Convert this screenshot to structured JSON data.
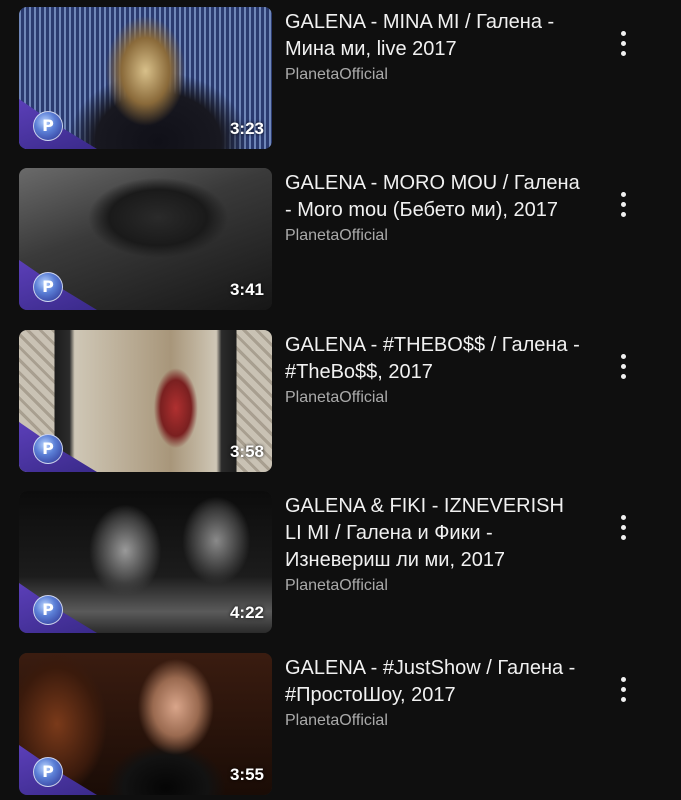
{
  "videos": [
    {
      "title": "GALENA - MINA MI / Галена - Мина ми, live 2017",
      "channel": "PlanetaOfficial",
      "duration": "3:23",
      "logo": "P"
    },
    {
      "title": "GALENA - MORO MOU / Галена - Moro mou (Бебето ми), 2017",
      "channel": "PlanetaOfficial",
      "duration": "3:41",
      "logo": "P"
    },
    {
      "title": "GALENA - #THEBO$$ / Галена - #TheBo$$, 2017",
      "channel": "PlanetaOfficial",
      "duration": "3:58",
      "logo": "P"
    },
    {
      "title": "GALENA & FIKI - IZNEVERISH LI MI / Галена и Фики - Изневериш ли ми, 2017",
      "channel": "PlanetaOfficial",
      "duration": "4:22",
      "logo": "P"
    },
    {
      "title": "GALENA - #JustShow / Галена - #ПростоШоу, 2017",
      "channel": "PlanetaOfficial",
      "duration": "3:55",
      "logo": "P"
    }
  ],
  "icons": {
    "more": "more-vertical-icon",
    "channel_logo": "planeta-logo-icon"
  },
  "colors": {
    "background": "#0f0f0f",
    "title": "#f1f1f1",
    "channel": "#aaaaaa",
    "badge": "#4b35a8"
  }
}
